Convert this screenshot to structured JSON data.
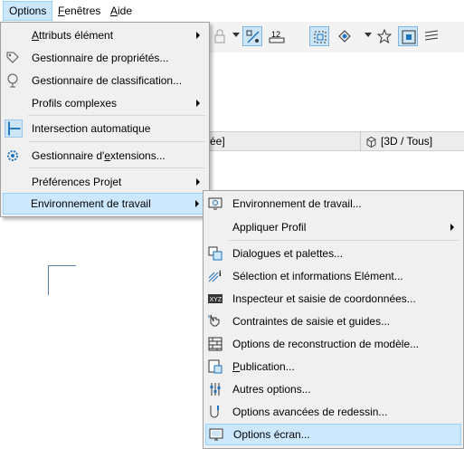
{
  "menubar": {
    "items": [
      {
        "label": "Options",
        "active": true
      },
      {
        "label": "Fenêtres",
        "active": false
      },
      {
        "label": "Aide",
        "active": false
      }
    ]
  },
  "toolbar": {
    "ruler_label": "12"
  },
  "tabstrip": {
    "left_label": "ée]",
    "tab_3d_label": "[3D / Tous]"
  },
  "options_menu": {
    "items": [
      {
        "label": "Attributs élément",
        "underline_index": 0,
        "submenu": true,
        "icon": "none"
      },
      {
        "label": "Gestionnaire de propriétés...",
        "underline_index": -1,
        "submenu": false,
        "icon": "tag-icon"
      },
      {
        "label": "Gestionnaire de classification...",
        "underline_index": -1,
        "submenu": false,
        "icon": "tree-icon"
      },
      {
        "label": "Profils complexes",
        "underline_index": -1,
        "submenu": true,
        "icon": "none"
      },
      {
        "label": "Intersection automatique",
        "underline_index": -1,
        "submenu": false,
        "icon": "intersection-icon"
      },
      {
        "label": "Gestionnaire d'extensions...",
        "underline_index": 14,
        "submenu": false,
        "icon": "extension-gear-icon"
      },
      {
        "label": "Préférences Projet",
        "underline_index": -1,
        "submenu": true,
        "icon": "none"
      },
      {
        "label": "Environnement de travail",
        "underline_index": -1,
        "submenu": true,
        "icon": "none",
        "highlighted": true
      }
    ]
  },
  "env_menu": {
    "items": [
      {
        "label": "Environnement de travail...",
        "icon": "monitor-settings-icon",
        "submenu": false
      },
      {
        "label": "Appliquer Profil",
        "icon": "none",
        "submenu": true
      },
      {
        "label": "Dialogues et palettes...",
        "icon": "palettes-icon",
        "submenu": false
      },
      {
        "label": "Sélection et informations Elément...",
        "icon": "selection-info-icon",
        "submenu": false
      },
      {
        "label": "Inspecteur et saisie de coordonnées...",
        "icon": "xyz-icon",
        "submenu": false
      },
      {
        "label": "Contraintes de saisie et guides...",
        "icon": "cursor-constraint-icon",
        "submenu": false
      },
      {
        "label": "Options de reconstruction de modèle...",
        "icon": "rebuild-bricks-icon",
        "submenu": false
      },
      {
        "label": "Publication...",
        "icon": "publish-icon",
        "submenu": false,
        "underline_index": 0
      },
      {
        "label": "Autres options...",
        "icon": "sliders-icon",
        "submenu": false
      },
      {
        "label": "Options avancées de redessin...",
        "icon": "redraw-icon",
        "submenu": false
      },
      {
        "label": "Options écran...",
        "icon": "screen-icon",
        "submenu": false,
        "highlighted": true
      }
    ]
  },
  "colors": {
    "highlight_bg": "#cce8ff",
    "highlight_border": "#99d1ff",
    "menu_bg": "#f0f0f0",
    "accent_blue": "#1e73be"
  }
}
